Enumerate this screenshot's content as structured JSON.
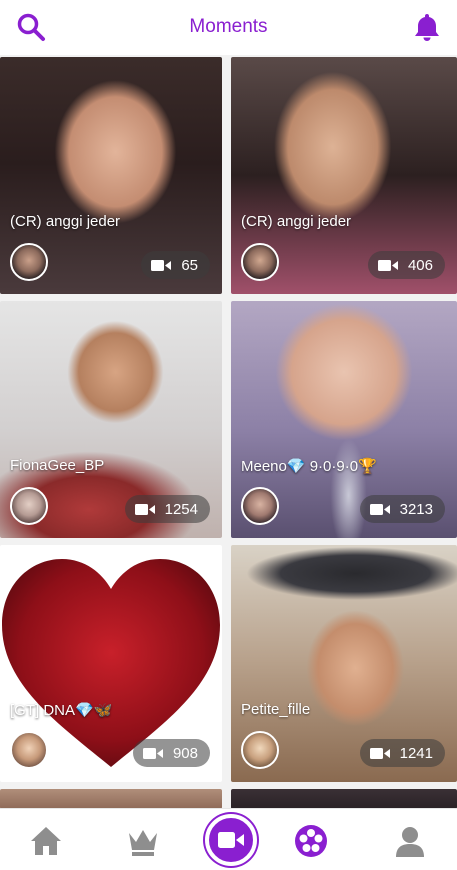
{
  "header": {
    "title": "Moments",
    "search_icon": "search-icon",
    "bell_icon": "bell-icon",
    "accent": "#8a1fd0"
  },
  "cards": [
    {
      "name": "(CR) anggi jeder",
      "count": "65"
    },
    {
      "name": "(CR) anggi jeder",
      "count": "406"
    },
    {
      "name": "FionaGee_BP",
      "count": "1254"
    },
    {
      "name": "Meeno💎 9·0·9·0🏆",
      "count": "3213"
    },
    {
      "name": "[GT] DNA💎🦋",
      "count": "908"
    },
    {
      "name": "Petite_fille",
      "count": "1241"
    }
  ],
  "nav": {
    "home_icon": "home-icon",
    "crown_icon": "crown-icon",
    "record_icon": "video-camera-icon",
    "reel_icon": "film-reel-icon",
    "profile_icon": "profile-icon"
  }
}
